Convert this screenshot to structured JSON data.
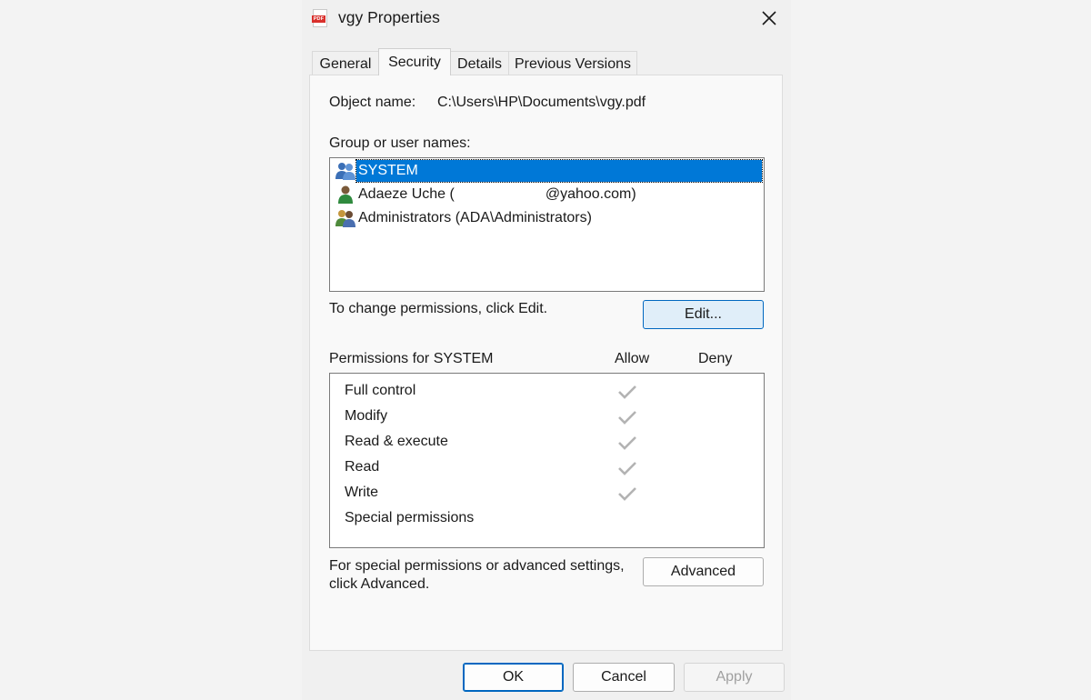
{
  "window": {
    "title": "vgy Properties",
    "icon": "pdf-file-icon",
    "icon_badge": "PDF"
  },
  "tabs": [
    {
      "label": "General",
      "active": false
    },
    {
      "label": "Security",
      "active": true
    },
    {
      "label": "Details",
      "active": false
    },
    {
      "label": "Previous Versions",
      "active": false
    }
  ],
  "security": {
    "object_name_label": "Object name:",
    "object_name_value": "C:\\Users\\HP\\Documents\\vgy.pdf",
    "group_label": "Group or user names:",
    "users": [
      {
        "name": "SYSTEM",
        "selected": true,
        "icon": "group-users-icon"
      },
      {
        "name_prefix": "Adaeze Uche (",
        "name_suffix": "@yahoo.com)",
        "selected": false,
        "icon": "user-icon"
      },
      {
        "name": "Administrators (ADA\\Administrators)",
        "selected": false,
        "icon": "admin-group-icon"
      }
    ],
    "change_hint": "To change permissions, click Edit.",
    "edit_label": "Edit...",
    "permissions_header": "Permissions for SYSTEM",
    "allow_header": "Allow",
    "deny_header": "Deny",
    "permissions": [
      {
        "name": "Full control",
        "allow": true,
        "deny": false
      },
      {
        "name": "Modify",
        "allow": true,
        "deny": false
      },
      {
        "name": "Read & execute",
        "allow": true,
        "deny": false
      },
      {
        "name": "Read",
        "allow": true,
        "deny": false
      },
      {
        "name": "Write",
        "allow": true,
        "deny": false
      },
      {
        "name": "Special permissions",
        "allow": false,
        "deny": false
      }
    ],
    "advanced_hint_line1": "For special permissions or advanced settings,",
    "advanced_hint_line2": "click Advanced.",
    "advanced_label": "Advanced"
  },
  "footer": {
    "ok_label": "OK",
    "cancel_label": "Cancel",
    "apply_label": "Apply"
  },
  "colors": {
    "selection": "#0078d7",
    "accent_border": "#0067c0",
    "pdf_red": "#d9302c"
  }
}
